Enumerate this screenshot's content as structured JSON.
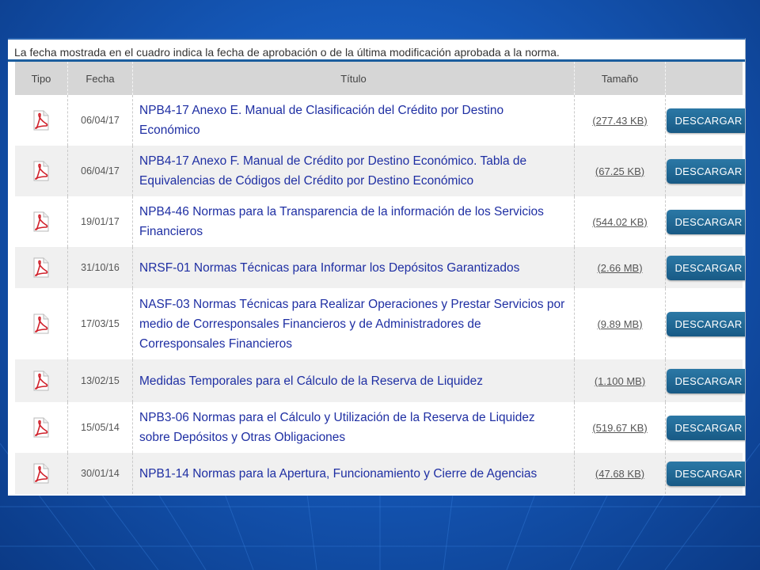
{
  "notice": "La fecha mostrada en el cuadro indica la fecha de aprobación o de la última modificación aprobada a la norma.",
  "headers": {
    "tipo": "Tipo",
    "fecha": "Fecha",
    "titulo": "Título",
    "tamano": "Tamaño",
    "accion": ""
  },
  "rows": [
    {
      "icon": "pdf-icon",
      "fecha": "06/04/17",
      "titulo": "NPB4-17 Anexo E. Manual de Clasificación del Crédito por Destino Económico",
      "tamano": "(277.43 KB)",
      "button": "DESCARGAR"
    },
    {
      "icon": "pdf-icon",
      "fecha": "06/04/17",
      "titulo": "NPB4-17 Anexo F. Manual de Crédito por Destino Económico. Tabla de Equivalencias de Códigos del Crédito por Destino Económico",
      "tamano": "(67.25 KB)",
      "button": "DESCARGAR"
    },
    {
      "icon": "pdf-icon",
      "fecha": "19/01/17",
      "titulo": "NPB4-46 Normas para la Transparencia de la información de los Servicios Financieros",
      "tamano": "(544.02 KB)",
      "button": "DESCARGAR"
    },
    {
      "icon": "pdf-icon",
      "fecha": "31/10/16",
      "titulo": "NRSF-01 Normas Técnicas para Informar los Depósitos Garantizados",
      "tamano": "(2.66 MB)",
      "button": "DESCARGAR"
    },
    {
      "icon": "pdf-icon",
      "fecha": "17/03/15",
      "titulo": "NASF-03 Normas Técnicas para Realizar Operaciones y Prestar Servicios por medio de Corresponsales Financieros y de Administradores de Corresponsales Financieros",
      "tamano": "(9.89 MB)",
      "button": "DESCARGAR"
    },
    {
      "icon": "pdf-icon",
      "fecha": "13/02/15",
      "titulo": "Medidas Temporales para el Cálculo de la Reserva de Liquidez",
      "tamano": "(1.100 MB)",
      "button": "DESCARGAR"
    },
    {
      "icon": "pdf-icon",
      "fecha": "15/05/14",
      "titulo": "NPB3-06 Normas para el Cálculo y Utilización de la Reserva de Liquidez sobre Depósitos y Otras Obligaciones",
      "tamano": "(519.67 KB)",
      "button": "DESCARGAR"
    },
    {
      "icon": "pdf-icon",
      "fecha": "30/01/14",
      "titulo": "NPB1-14 Normas para la Apertura, Funcionamiento y Cierre de Agencias",
      "tamano": "(47.68 KB)",
      "button": "DESCARGAR"
    }
  ],
  "colors": {
    "link": "#1f2fa3",
    "button": "#1f6a98",
    "header_bg": "#d6d6d6",
    "accent": "#1b5e9e",
    "pdf_red": "#d0202a"
  }
}
